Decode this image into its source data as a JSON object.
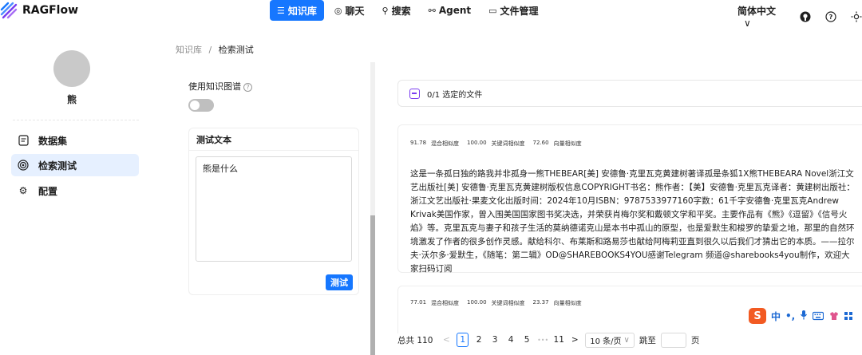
{
  "app": {
    "name": "RAGFlow"
  },
  "nav": [
    {
      "label": "知识库",
      "icon": "database-icon",
      "active": true
    },
    {
      "label": "聊天",
      "icon": "chat-icon",
      "active": false
    },
    {
      "label": "搜索",
      "icon": "search-icon",
      "active": false
    },
    {
      "label": "Agent",
      "icon": "agent-icon",
      "active": false
    },
    {
      "label": "文件管理",
      "icon": "folder-icon",
      "active": false
    }
  ],
  "header": {
    "language": "简体中文",
    "language_caret": "∨"
  },
  "user": {
    "name": "熊"
  },
  "sidebar": {
    "items": [
      {
        "label": "数据集",
        "icon": "dataset-icon"
      },
      {
        "label": "检索测试",
        "icon": "retrieval-icon",
        "active": true
      },
      {
        "label": "配置",
        "icon": "gear-icon"
      }
    ]
  },
  "breadcrumb": {
    "root": "知识库",
    "sep": "/",
    "current": "检索测试"
  },
  "left": {
    "kg_label": "使用知识图谱",
    "test_title": "测试文本",
    "test_value": "熊是什么",
    "test_button": "测试"
  },
  "right": {
    "selected_files": "0/1 选定的文件",
    "results": [
      {
        "hybrid": "91.78",
        "hybrid_label": "混合相似度",
        "keyword": "100.00",
        "keyword_label": "关键词相似度",
        "vector": "72.60",
        "vector_label": "向量相似度",
        "text": "这是一条孤日独的路我并非孤身一熊THEBEAR[美] 安德鲁·克里瓦克黄建树著译孤是条狐1X熊THEBEARA Novel浙江文艺出版社[美] 安德鲁·克里瓦克黄建树版权信息COPYRIGHT书名：熊作者：【美】安德鲁·克里瓦克译者：黄建树出版社：浙江文艺出版社·果麦文化出版时间：2024年10月ISBN：9787533977160字数：61千字安德鲁·克里瓦克Andrew Krivak美国作家，曾入围美国国家图书奖决选，并荣获肖梅尔奖和戴顿文学和平奖。主要作品有《熊》《逗留》《信号火焰》等。克里瓦克与妻子和孩子生活的莫纳德诺克山是本书中孤山的原型，也是爱默生和梭罗的挚爱之地，那里的自然环境激发了作者的很多创作灵感。献给科尔、布莱斯和路易莎也献给阿梅莉亚直到很久以后我们才猜出它的本质。——拉尔夫·沃尔多·爱默生，《随笔：第二辑》OD@SHAREBOOKS4YOU感谢Telegram 频道@sharebooks4you制作，欢迎大家扫码订阅"
      },
      {
        "hybrid": "77.01",
        "hybrid_label": "混合相似度",
        "keyword": "100.00",
        "keyword_label": "关键词相似度",
        "vector": "23.37",
        "vector_label": "向量相似度",
        "text": ""
      }
    ]
  },
  "pagination": {
    "total_label": "总共 110",
    "prev": "<",
    "pages": [
      "1",
      "2",
      "3",
      "4",
      "5"
    ],
    "ellipsis": "•••",
    "last": "11",
    "next": ">",
    "page_size": "10 条/页",
    "page_size_caret": "∨",
    "jump_label": "跳至",
    "page_suffix": "页"
  },
  "ime": {
    "s": "S",
    "lang": "中",
    "punct": "•,"
  }
}
